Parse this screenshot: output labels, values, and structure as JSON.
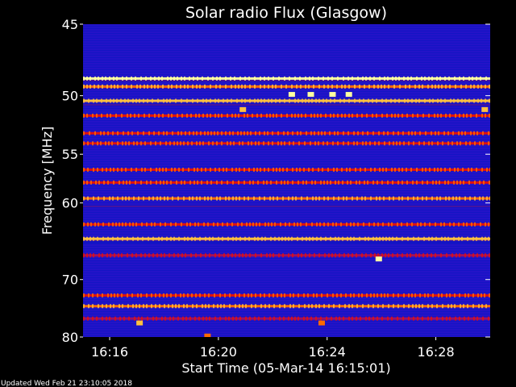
{
  "chart_data": {
    "type": "heatmap",
    "title": "Solar radio Flux (Glasgow)",
    "xlabel": "Start Time (05-Mar-14 16:15:01)",
    "ylabel": "Frequency [MHz]",
    "updated_text": "Updated Wed Feb 21 23:10:05 2018",
    "x_ticks": [
      {
        "label": "16:16",
        "minutes": 16
      },
      {
        "label": "16:20",
        "minutes": 20
      },
      {
        "label": "16:24",
        "minutes": 24
      },
      {
        "label": "16:28",
        "minutes": 28
      }
    ],
    "x_range_minutes": [
      15.02,
      30.0
    ],
    "y_ticks": [
      {
        "label": "45",
        "value": 45
      },
      {
        "label": "50",
        "value": 50
      },
      {
        "label": "55",
        "value": 55
      },
      {
        "label": "60",
        "value": 60
      },
      {
        "label": "70",
        "value": 70
      },
      {
        "label": "80",
        "value": 80
      }
    ],
    "y_range": [
      45,
      80
    ],
    "y_scale": "reciprocal",
    "colormap": [
      "#1010c8",
      "#4010d0",
      "#a01060",
      "#e01010",
      "#ff6a00",
      "#ffc040",
      "#ffffa0"
    ],
    "bands": [
      {
        "freq": 48.7,
        "intensity": 0.95
      },
      {
        "freq": 49.3,
        "intensity": 0.7
      },
      {
        "freq": 50.4,
        "intensity": 0.75
      },
      {
        "freq": 51.6,
        "intensity": 0.45
      },
      {
        "freq": 53.1,
        "intensity": 0.55
      },
      {
        "freq": 54.0,
        "intensity": 0.5
      },
      {
        "freq": 56.5,
        "intensity": 0.5
      },
      {
        "freq": 57.8,
        "intensity": 0.45
      },
      {
        "freq": 59.5,
        "intensity": 0.6
      },
      {
        "freq": 62.5,
        "intensity": 0.45
      },
      {
        "freq": 64.3,
        "intensity": 0.75
      },
      {
        "freq": 66.5,
        "intensity": 0.35
      },
      {
        "freq": 72.5,
        "intensity": 0.45
      },
      {
        "freq": 74.3,
        "intensity": 0.7
      },
      {
        "freq": 76.5,
        "intensity": 0.35
      }
    ],
    "bursts": [
      {
        "minutes": 25.9,
        "freq": 67.0,
        "intensity": 1.0
      },
      {
        "minutes": 17.1,
        "freq": 77.3,
        "intensity": 0.9
      },
      {
        "minutes": 19.6,
        "freq": 79.8,
        "intensity": 0.7
      },
      {
        "minutes": 23.8,
        "freq": 77.3,
        "intensity": 0.7
      },
      {
        "minutes": 20.9,
        "freq": 51.1,
        "intensity": 0.8
      },
      {
        "minutes": 29.8,
        "freq": 51.1,
        "intensity": 0.8
      },
      {
        "minutes": 24.2,
        "freq": 49.9,
        "intensity": 1.0
      },
      {
        "minutes": 22.7,
        "freq": 49.9,
        "intensity": 1.0
      },
      {
        "minutes": 23.4,
        "freq": 49.9,
        "intensity": 1.0
      },
      {
        "minutes": 24.8,
        "freq": 49.9,
        "intensity": 1.0
      }
    ]
  }
}
